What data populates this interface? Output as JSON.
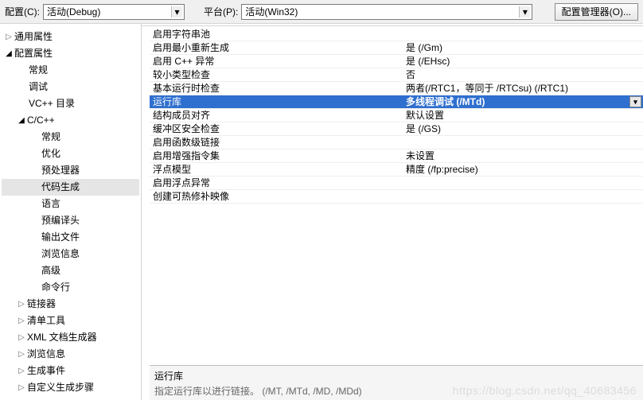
{
  "topbar": {
    "config_label": "配置(C):",
    "config_value": "活动(Debug)",
    "platform_label": "平台(P):",
    "platform_value": "活动(Win32)",
    "manager_button": "配置管理器(O)..."
  },
  "tree": {
    "general": "通用属性",
    "config": "配置属性",
    "items": {
      "general2": "常规",
      "debug": "调试",
      "vcdirs": "VC++ 目录",
      "cc": "C/C++",
      "cc_children": {
        "general": "常规",
        "opt": "优化",
        "preproc": "预处理器",
        "codegen": "代码生成",
        "lang": "语言",
        "pch": "预编译头",
        "output": "输出文件",
        "browse": "浏览信息",
        "adv": "高级",
        "cmdline": "命令行"
      },
      "linker": "链接器",
      "manifest": "清单工具",
      "xmldoc": "XML 文档生成器",
      "browseinfo": "浏览信息",
      "buildevt": "生成事件",
      "custom": "自定义生成步骤"
    }
  },
  "grid": [
    {
      "name": "启用字符串池",
      "value": ""
    },
    {
      "name": "启用最小重新生成",
      "value": "是 (/Gm)"
    },
    {
      "name": "启用 C++ 异常",
      "value": "是 (/EHsc)"
    },
    {
      "name": "较小类型检查",
      "value": "否"
    },
    {
      "name": "基本运行时检查",
      "value": "两者(/RTC1，等同于 /RTCsu) (/RTC1)"
    },
    {
      "name": "运行库",
      "value": "多线程调试 (/MTd)",
      "selected": true
    },
    {
      "name": "结构成员对齐",
      "value": "默认设置"
    },
    {
      "name": "缓冲区安全检查",
      "value": "是 (/GS)"
    },
    {
      "name": "启用函数级链接",
      "value": ""
    },
    {
      "name": "启用增强指令集",
      "value": "未设置"
    },
    {
      "name": "浮点模型",
      "value": "精度 (/fp:precise)"
    },
    {
      "name": "启用浮点异常",
      "value": ""
    },
    {
      "name": "创建可热修补映像",
      "value": ""
    }
  ],
  "desc": {
    "title": "运行库",
    "body": "指定运行库以进行链接。    (/MT, /MTd, /MD, /MDd)"
  },
  "watermark": "https://blog.csdn.net/qq_40683456"
}
